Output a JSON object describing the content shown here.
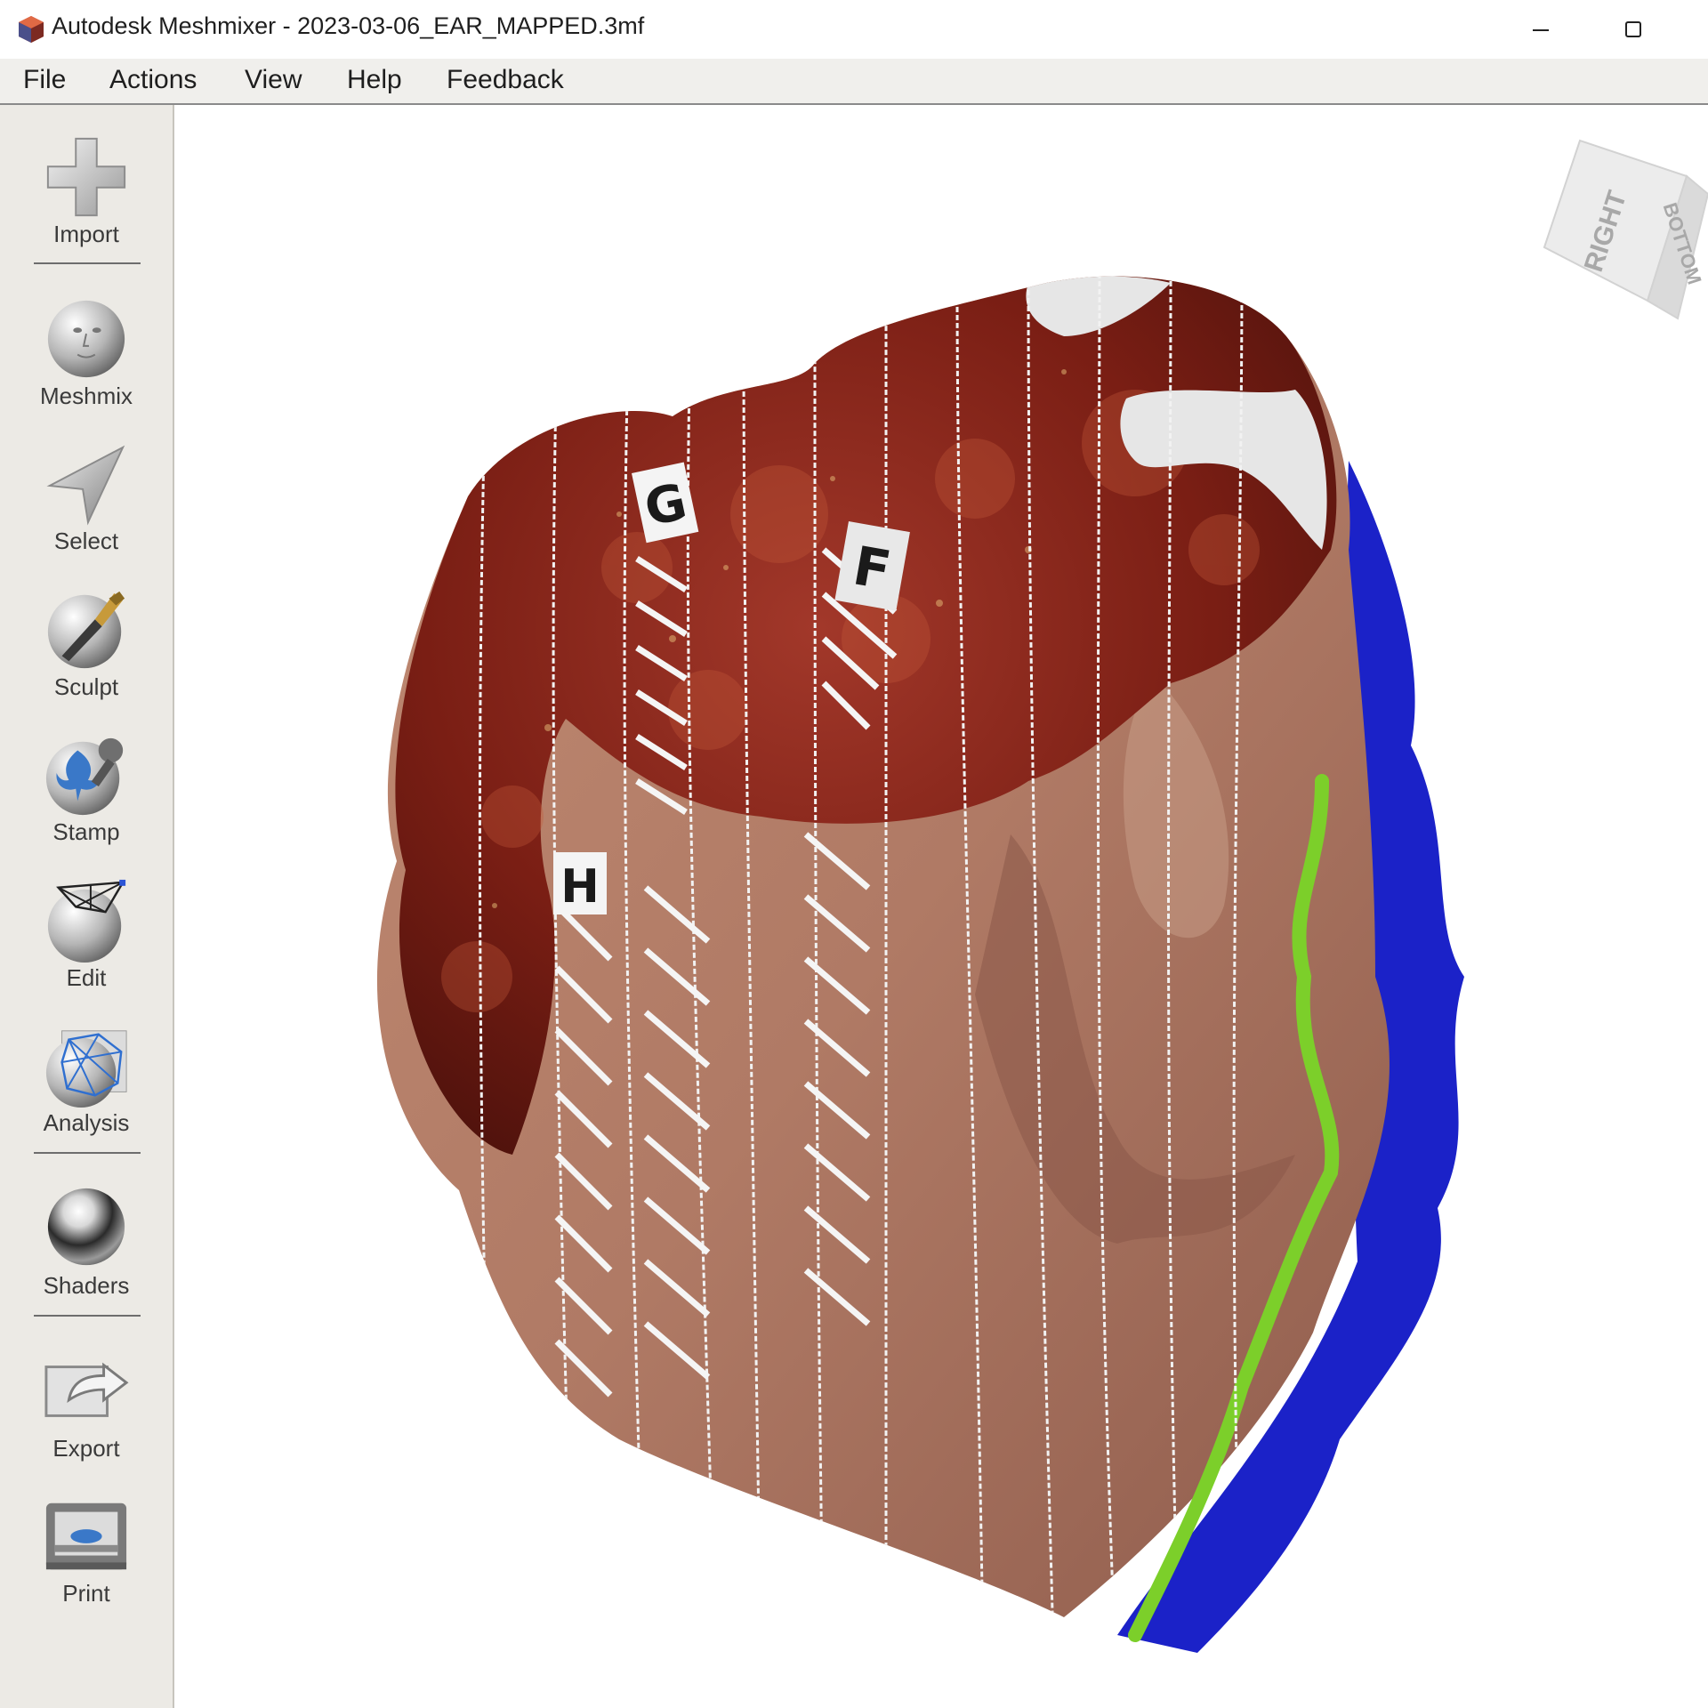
{
  "window": {
    "title": "Autodesk Meshmixer - 2023-03-06_EAR_MAPPED.3mf",
    "controls": [
      "minimize-icon",
      "maximize-icon"
    ]
  },
  "menu": {
    "items": [
      "File",
      "Actions",
      "View",
      "Help",
      "Feedback"
    ]
  },
  "toolbar": {
    "tools": [
      {
        "label": "Import",
        "icon": "import-plus-icon"
      },
      {
        "label": "Meshmix",
        "icon": "meshmix-face-icon"
      },
      {
        "label": "Select",
        "icon": "select-arrow-icon"
      },
      {
        "label": "Sculpt",
        "icon": "sculpt-brush-icon"
      },
      {
        "label": "Stamp",
        "icon": "stamp-icon"
      },
      {
        "label": "Edit",
        "icon": "edit-mesh-icon"
      },
      {
        "label": "Analysis",
        "icon": "analysis-mesh-icon"
      },
      {
        "label": "Shaders",
        "icon": "shaders-sphere-icon"
      },
      {
        "label": "Export",
        "icon": "export-icon"
      },
      {
        "label": "Print",
        "icon": "print-icon"
      }
    ]
  },
  "viewport": {
    "nav_cube": {
      "face_front": "RIGHT",
      "face_side": "BOTTOM"
    },
    "markers": [
      "G",
      "F",
      "H"
    ]
  },
  "colors": {
    "skin": "#b07a65",
    "lesion": "#7a1e14",
    "margin_blue": "#1b22c8",
    "margin_green": "#7ccf2a",
    "gauze": "#e6e6e6"
  }
}
